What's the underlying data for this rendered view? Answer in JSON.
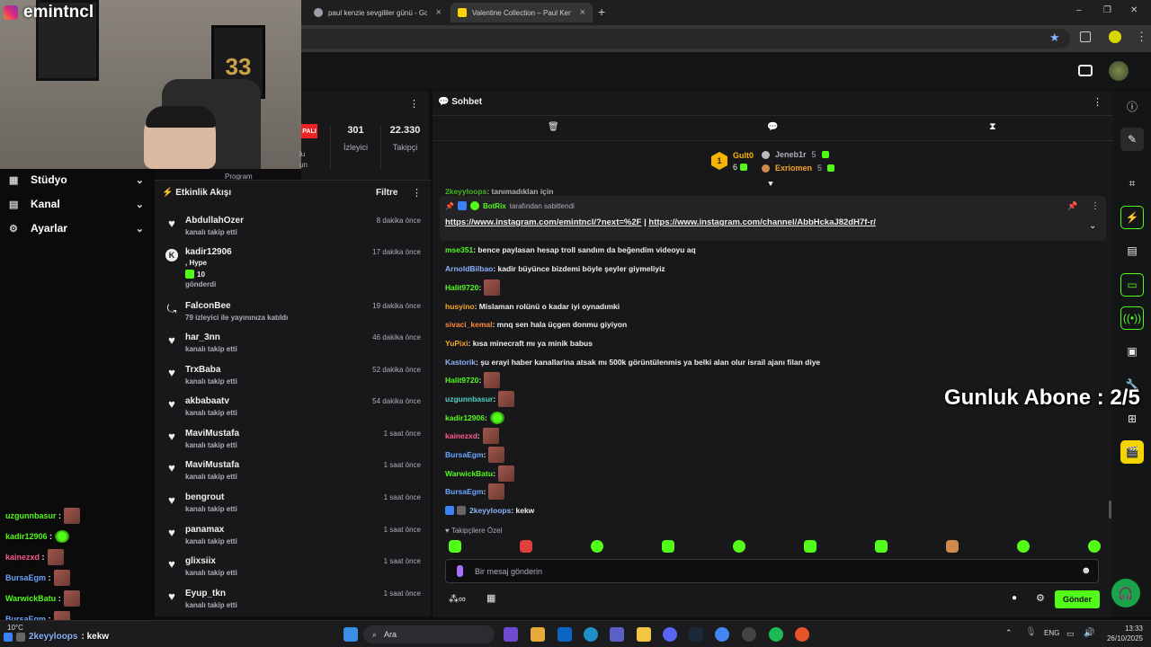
{
  "browser": {
    "tabs": [
      {
        "title": "paul kenzie sevgililer günü - Go"
      },
      {
        "title": "Valentine Collection – Paul Ken"
      }
    ],
    "new_tab": "+",
    "window_controls": {
      "minimize": "–",
      "restore": "❐",
      "close": "✕"
    }
  },
  "webcam": {
    "handle": "emintncl",
    "platform_icon": "instagram-icon",
    "jersey": "33"
  },
  "left_menu": {
    "items": [
      {
        "label": "Stüdyo",
        "icon": "grid-icon"
      },
      {
        "label": "Kanal",
        "icon": "channel-icon"
      },
      {
        "label": "Ayarlar",
        "icon": "gear-icon"
      }
    ]
  },
  "stats": {
    "live_badge": "PALI",
    "viewers": {
      "value": "301",
      "label": "İzleyici"
    },
    "followers": {
      "value": "22.330",
      "label": "Takipçi"
    },
    "partial_labels": [
      "lu",
      "un",
      "Program"
    ]
  },
  "feed": {
    "title": "Etkinlik Akışı",
    "filter": "Filtre",
    "menu": "⋮",
    "items": [
      {
        "name": "AbdullahOzer",
        "sub": "kanalı takip etti",
        "time": "8 dakika önce",
        "icon": "heart"
      },
      {
        "name": "kadir12906",
        "extra1": ", Hype",
        "extra2": "10",
        "sub": "gönderdi",
        "time": "17 dakika önce",
        "icon": "kick"
      },
      {
        "name": "FalconBee",
        "sub": "79 izleyici ile yayınınıza katıldı",
        "time": "19 dakika önce",
        "icon": "raid"
      },
      {
        "name": "har_3nn",
        "sub": "kanalı takip etti",
        "time": "46 dakika önce",
        "icon": "heart"
      },
      {
        "name": "TrxBaba",
        "sub": "kanalı takip etti",
        "time": "52 dakika önce",
        "icon": "heart"
      },
      {
        "name": "akbabaatv",
        "sub": "kanalı takip etti",
        "time": "54 dakika önce",
        "icon": "heart"
      },
      {
        "name": "MaviMustafa",
        "sub": "kanalı takip etti",
        "time": "1 saat önce",
        "icon": "heart"
      },
      {
        "name": "MaviMustafa",
        "sub": "kanalı takip etti",
        "time": "1 saat önce",
        "icon": "heart"
      },
      {
        "name": "bengrout",
        "sub": "kanalı takip etti",
        "time": "1 saat önce",
        "icon": "heart"
      },
      {
        "name": "panamax",
        "sub": "kanalı takip etti",
        "time": "1 saat önce",
        "icon": "heart"
      },
      {
        "name": "glixsiix",
        "sub": "kanalı takip etti",
        "time": "1 saat önce",
        "icon": "heart"
      },
      {
        "name": "Eyup_tkn",
        "sub": "kanalı takip etti",
        "time": "1 saat önce",
        "icon": "heart"
      }
    ]
  },
  "chat": {
    "title": "Sohbet",
    "leaderboard": [
      {
        "rank": "1",
        "name": "Gult0",
        "count": "6"
      },
      {
        "name": "Jeneb1r",
        "count": "5"
      },
      {
        "name": "Exriomen",
        "count": "5"
      }
    ],
    "pinned": {
      "by": "BotRix",
      "by_suffix": "tarafından sabitlendi",
      "link1": "https://www.instagram.com/emintncl/?next=%2F",
      "sep": "|",
      "link2": "https://www.instagram.com/channel/AbbHckaJ82dH7f-r/"
    },
    "messages": [
      {
        "user": "mse351",
        "color": "#53fc18",
        "text": ": bence paylasan hesap troll sandım da beğendim videoyu aq"
      },
      {
        "user": "ArnoldBilbao",
        "color": "#8ab4f8",
        "text": ": kadir büyünce bizdemi böyle şeyler giymeliyiz"
      },
      {
        "user": "Halit9720",
        "color": "#53fc18",
        "text": ":",
        "emote": "brown"
      },
      {
        "user": "husyino",
        "color": "#f5a623",
        "text": ": Mislaman rolünü o kadar iyi oynadımki"
      },
      {
        "user": "sivaci_kemal",
        "color": "#ff8a3d",
        "text": ": mnq sen hala üçgen donmu giyiyon"
      },
      {
        "user": "YuPixi",
        "color": "#f5a623",
        "text": ": kısa minecraft mı ya minik babus"
      },
      {
        "user": "Kastorik",
        "color": "#8ab4f8",
        "text": ": şu erayi haber kanallarina atsak mı 500k görüntülenmis ya belki alan olur israil ajanı filan diye"
      },
      {
        "user": "Halit9720",
        "color": "#53fc18",
        "text": ":",
        "emote": "brown"
      },
      {
        "user": "uzgunnbasur",
        "color": "#4fd1c5",
        "text": ":",
        "emote": "brown"
      },
      {
        "user": "kadir12906",
        "color": "#53fc18",
        "text": ":",
        "emote": "green"
      },
      {
        "user": "kainezxd",
        "color": "#ff5a8a",
        "text": ":",
        "emote": "brown"
      },
      {
        "user": "BursaEgm",
        "color": "#6aa7ff",
        "text": ":",
        "emote": "brown"
      },
      {
        "user": "WarwickBatu",
        "color": "#53fc18",
        "text": ":",
        "emote": "brown"
      },
      {
        "user": "BursaEgm",
        "color": "#6aa7ff",
        "text": ":",
        "emote": "brown"
      },
      {
        "user": "2keyyloops",
        "color": "#8ab4f8",
        "text": ": kekw",
        "badges": true
      }
    ],
    "partial_msg": {
      "user": "2keyyloops",
      "text": ": tanımadıklan için"
    },
    "subs_only_label": "Takipçilere Özel",
    "input_placeholder": "Bir mesaj gönderin",
    "send_label": "Gönder"
  },
  "overlay": {
    "sub_goal": "Gunluk Abone : 2/5",
    "left_chat": [
      {
        "user": "uzgunnbasur",
        "color": "#53fc18",
        "emote": "brown"
      },
      {
        "user": "kadir12906",
        "color": "#53fc18",
        "emote": "green"
      },
      {
        "user": "kainezxd",
        "color": "#ff5a8a",
        "emote": "brown"
      },
      {
        "user": "BursaEgm",
        "color": "#6aa7ff",
        "emote": "brown"
      },
      {
        "user": "WarwickBatu",
        "color": "#53fc18",
        "emote": "brown"
      },
      {
        "user": "BursaEgm",
        "color": "#6aa7ff",
        "emote": "brown"
      }
    ],
    "left_last": {
      "user": "2keyyloops",
      "text": ": kekw"
    }
  },
  "taskbar": {
    "search": "Ara",
    "weather": "10°C",
    "lang": "ENG",
    "time": "13:33",
    "date": "26/10/2025"
  },
  "colors": {
    "kick_green": "#53fc18",
    "panel": "#18181b",
    "bg": "#0e0e10"
  }
}
